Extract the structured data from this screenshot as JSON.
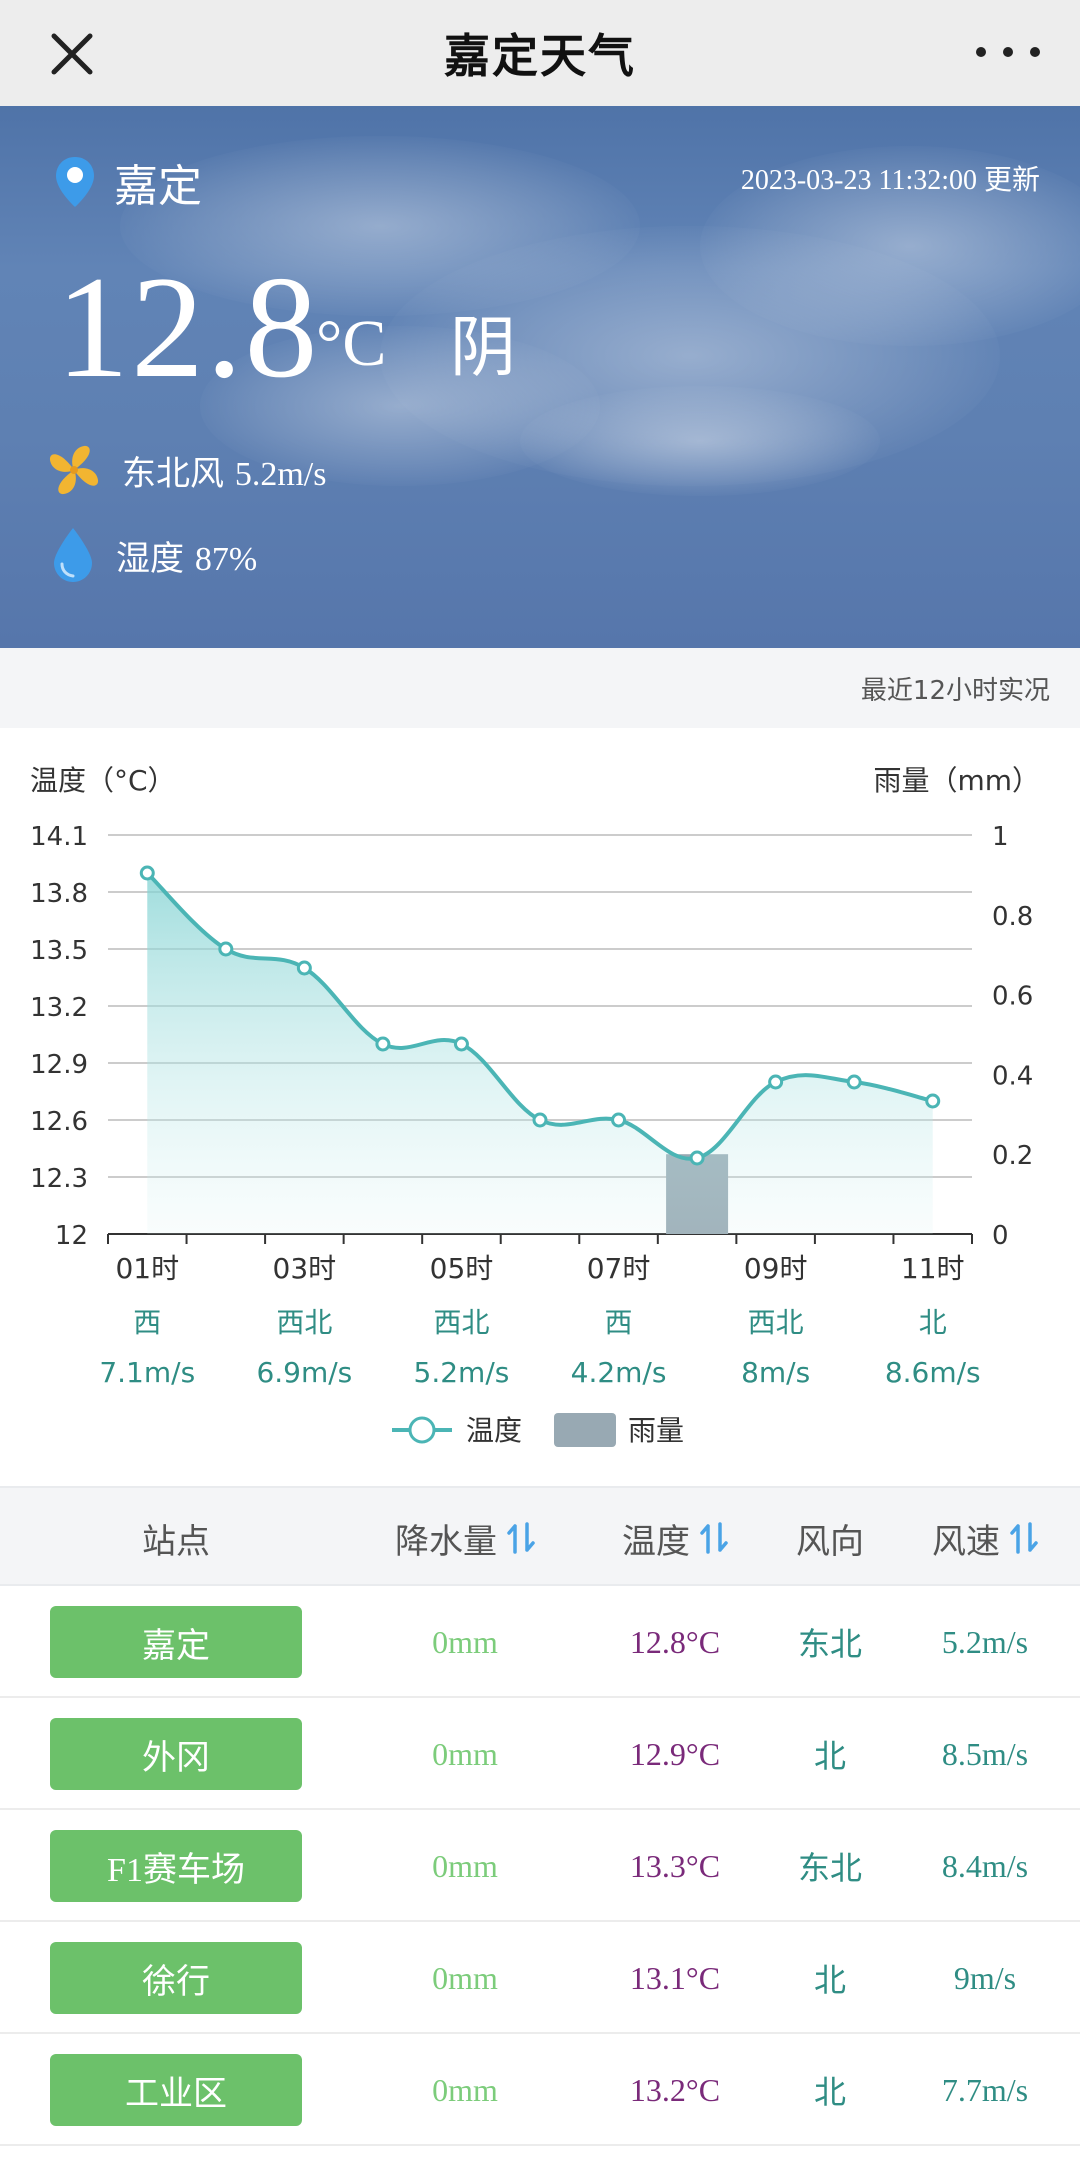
{
  "nav": {
    "title": "嘉定天气",
    "close_icon": "close-icon",
    "more_icon": "more-icon"
  },
  "current": {
    "location": "嘉定",
    "update_time": "2023-03-23 11:32:00 更新",
    "temperature": "12.8",
    "unit": "°C",
    "condition": "阴",
    "wind_dir": "东北风",
    "wind_speed": "5.2m/s",
    "humidity_label": "湿度",
    "humidity": "87%",
    "colors": {
      "wind_icon": "#f2b531",
      "humidity_icon": "#3d9be9",
      "location_icon": "#3d9be9"
    }
  },
  "recent_label": "最近12小时实况",
  "chart_data": {
    "type": "line",
    "y_left_label": "温度（°C）",
    "y_right_label": "雨量（mm）",
    "y_left_ticks": [
      "14.1",
      "13.8",
      "13.5",
      "13.2",
      "12.9",
      "12.6",
      "12.3",
      "12"
    ],
    "y_right_ticks": [
      "1",
      "0.8",
      "0.6",
      "0.4",
      "0.2",
      "0"
    ],
    "ylim_left": [
      12,
      14.1
    ],
    "ylim_right": [
      0,
      1
    ],
    "x": [
      1,
      2,
      3,
      4,
      5,
      6,
      7,
      8,
      9,
      10,
      11
    ],
    "x_tick_labels": [
      "01时",
      "03时",
      "05时",
      "07时",
      "09时",
      "11时"
    ],
    "series": [
      {
        "name": "温度",
        "type": "line",
        "color": "#4bb5b5",
        "values": [
          13.9,
          13.5,
          13.4,
          13.0,
          13.0,
          12.6,
          12.6,
          12.4,
          12.8,
          12.8,
          12.7
        ]
      },
      {
        "name": "雨量",
        "type": "bar",
        "color": "#98a9b3",
        "values": [
          0,
          0,
          0,
          0,
          0,
          0,
          0,
          0.2,
          0,
          0,
          0
        ]
      }
    ],
    "wind_dirs": [
      "西",
      "西北",
      "西北",
      "西",
      "西北",
      "北"
    ],
    "wind_speeds": [
      "7.1m/s",
      "6.9m/s",
      "5.2m/s",
      "4.2m/s",
      "8m/s",
      "8.6m/s"
    ],
    "legend": [
      "温度",
      "雨量"
    ]
  },
  "table": {
    "headers": {
      "station": "站点",
      "rain": "降水量",
      "temp": "温度",
      "dir": "风向",
      "speed": "风速"
    },
    "rows": [
      {
        "station": "嘉定",
        "rain": "0mm",
        "temp": "12.8°C",
        "dir": "东北",
        "speed": "5.2m/s"
      },
      {
        "station": "外冈",
        "rain": "0mm",
        "temp": "12.9°C",
        "dir": "北",
        "speed": "8.5m/s"
      },
      {
        "station": "F1赛车场",
        "rain": "0mm",
        "temp": "13.3°C",
        "dir": "东北",
        "speed": "8.4m/s"
      },
      {
        "station": "徐行",
        "rain": "0mm",
        "temp": "13.1°C",
        "dir": "北",
        "speed": "9m/s"
      },
      {
        "station": "工业区",
        "rain": "0mm",
        "temp": "13.2°C",
        "dir": "北",
        "speed": "7.7m/s"
      }
    ]
  }
}
